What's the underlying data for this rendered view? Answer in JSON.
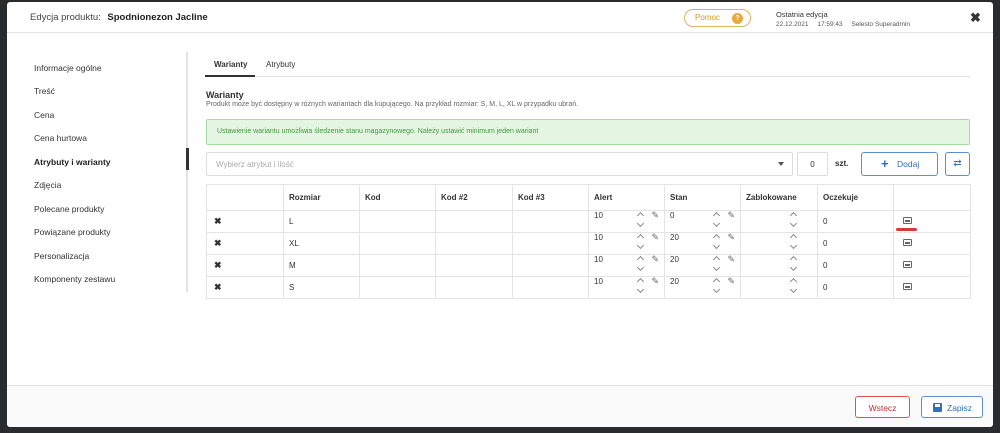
{
  "header": {
    "title_prefix": "Edycja produktu:",
    "product_name": "Spodnionezon Jacline",
    "help_label": "Pomoc",
    "help_icon": "?",
    "last_edit_label": "Ostatnia edycja",
    "last_edit_date": "22.12.2021",
    "last_edit_time": "17:59:43",
    "last_edit_user": "Selesto Superadmin",
    "close_icon": "✖"
  },
  "sidebar": {
    "items": [
      {
        "label": "Informacje ogólne"
      },
      {
        "label": "Treść"
      },
      {
        "label": "Cena"
      },
      {
        "label": "Cena hurtowa"
      },
      {
        "label": "Atrybuty i warianty",
        "active": true
      },
      {
        "label": "Zdjęcia"
      },
      {
        "label": "Polecane produkty"
      },
      {
        "label": "Powiązane produkty"
      },
      {
        "label": "Personalizacja"
      },
      {
        "label": "Komponenty zestawu"
      }
    ]
  },
  "tabs": [
    {
      "label": "Warianty",
      "active": true
    },
    {
      "label": "Atrybuty"
    }
  ],
  "section": {
    "title": "Warianty",
    "description": "Produkt może być dostępny w różnych wariantach dla kupującego. Na przykład rozmiar: S, M, L, XL w przypadku ubrań."
  },
  "alert": "Ustawienie wariantu umożliwia śledzenie stanu magazynowego. Należy ustawić minimum jeden wariant",
  "controls": {
    "attribute_placeholder": "Wybierz atrybut i ilość",
    "quantity": "0",
    "unit": "szt.",
    "add_label": "Dodaj",
    "add_icon": "+",
    "refresh_icon": "⇄"
  },
  "table": {
    "headers": [
      "",
      "Rozmiar",
      "Kod",
      "Kod #2",
      "Kod #3",
      "Alert",
      "Stan",
      "Zablokowane",
      "Oczekuje",
      ""
    ],
    "rows": [
      {
        "remove": "✖",
        "size": "L",
        "alert": "10",
        "stock": "0",
        "pending": "0"
      },
      {
        "remove": "✖",
        "size": "XL",
        "alert": "10",
        "stock": "20",
        "pending": "0"
      },
      {
        "remove": "✖",
        "size": "M",
        "alert": "10",
        "stock": "20",
        "pending": "0"
      },
      {
        "remove": "✖",
        "size": "S",
        "alert": "10",
        "stock": "20",
        "pending": "0"
      }
    ]
  },
  "footer": {
    "back_label": "Wstecz",
    "save_label": "Zapisz"
  },
  "colors": {
    "accent": "#2f6fbd",
    "danger": "#c9302c",
    "success_bg": "#e4f6e2",
    "help": "#e8a93b"
  }
}
